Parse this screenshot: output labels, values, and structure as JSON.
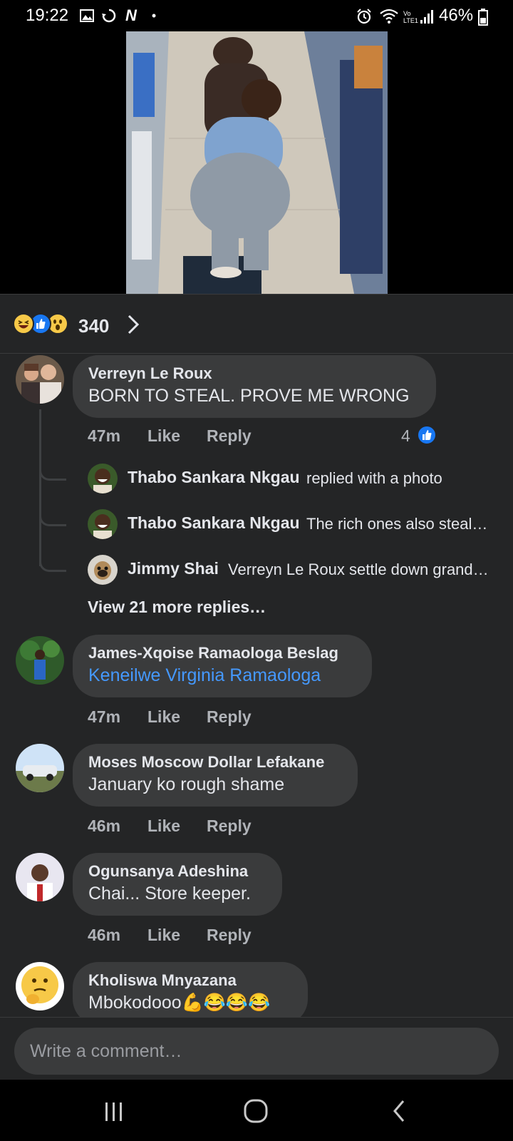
{
  "status_bar": {
    "time": "19:22",
    "battery": "46%",
    "left_icons": [
      "gallery-icon",
      "sync-icon",
      "n-icon",
      "dot-icon"
    ],
    "right_icons": [
      "alarm-icon",
      "wifi-icon",
      "signal-icon",
      "battery-icon"
    ]
  },
  "reactions": {
    "emojis": [
      "haha-reaction",
      "like-reaction",
      "wow-reaction"
    ],
    "count": "340"
  },
  "comments": [
    {
      "name": "Verreyn Le Roux",
      "text": "BORN TO STEAL. PROVE ME WRONG",
      "time": "47m",
      "like": "Like",
      "reply": "Reply",
      "reaction_count": "4"
    },
    {
      "name": "James-Xqoise Ramaologa Beslag",
      "text": "Keneilwe Virginia Ramaologa",
      "time": "47m",
      "like": "Like",
      "reply": "Reply"
    },
    {
      "name": "Moses Moscow Dollar Lefakane",
      "text": "January ko rough shame",
      "time": "46m",
      "like": "Like",
      "reply": "Reply"
    },
    {
      "name": "Ogunsanya Adeshina",
      "text": "Chai... Store keeper.",
      "time": "46m",
      "like": "Like",
      "reply": "Reply"
    },
    {
      "name": "Kholiswa Mnyazana",
      "text": "Mbokodooo💪😂😂😂"
    }
  ],
  "replies": [
    {
      "name": "Thabo Sankara Nkgau",
      "text": "replied with a photo"
    },
    {
      "name": "Thabo Sankara Nkgau",
      "text": "The rich ones also steal…"
    },
    {
      "name": "Jimmy Shai",
      "text": "Verreyn Le Roux settle down grand…"
    }
  ],
  "view_more": "View 21 more replies…",
  "composer": {
    "placeholder": "Write a comment…"
  },
  "colors": {
    "background": "#242526",
    "bubble": "#3a3b3c",
    "link": "#4599ff",
    "like_blue": "#1877f2"
  }
}
